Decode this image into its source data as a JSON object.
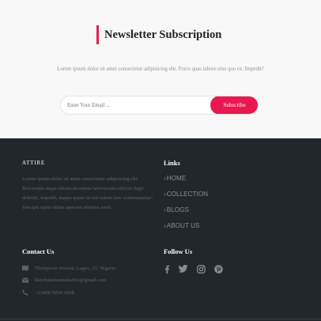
{
  "newsletter": {
    "title": "Newsletter Subscription",
    "description": "Lorem ipsum dolor sit amet consectetur adipisicing elit. Porro quas labore eius quo ex. Impedit?",
    "email_placeholder": "Enter Your Email ...",
    "subscribe_label": "Subscribe",
    "accent_color": "#e8194f"
  },
  "footer": {
    "brand": "ATTIRE",
    "about": "Lorem ipsum dolor sit amet consectetur adipisicing elit. Reiciendis atque obcaecati minus laboriosam officiis fugit deleniti, impedit, itaque quam in sed autem iure consequuntur! Suscipit optio ullam aperiam minima amet.",
    "links_title": "Links",
    "links": [
      {
        "icon": "chevron-right-icon",
        "label": "HOME"
      },
      {
        "icon": "chevron-right-icon",
        "label": "COLLECTION"
      },
      {
        "icon": "chevron-right-icon",
        "label": "BLOGS"
      },
      {
        "icon": "chevron-right-icon",
        "label": "ABOUT US"
      }
    ],
    "contact_title": "Contact Us",
    "contacts": [
      {
        "icon": "map-icon",
        "text": "Thompson Avenue, Lagos, 23, Nigeria"
      },
      {
        "icon": "envelope-icon",
        "text": "Ikechukwuemeka493@gmail.com"
      },
      {
        "icon": "phone-icon",
        "text": "+23490 9094 9908"
      }
    ],
    "follow_title": "Follow Us",
    "social": [
      "facebook-icon",
      "twitter-icon",
      "instagram-icon",
      "pinterest-icon"
    ],
    "background_color": "#21272b"
  }
}
